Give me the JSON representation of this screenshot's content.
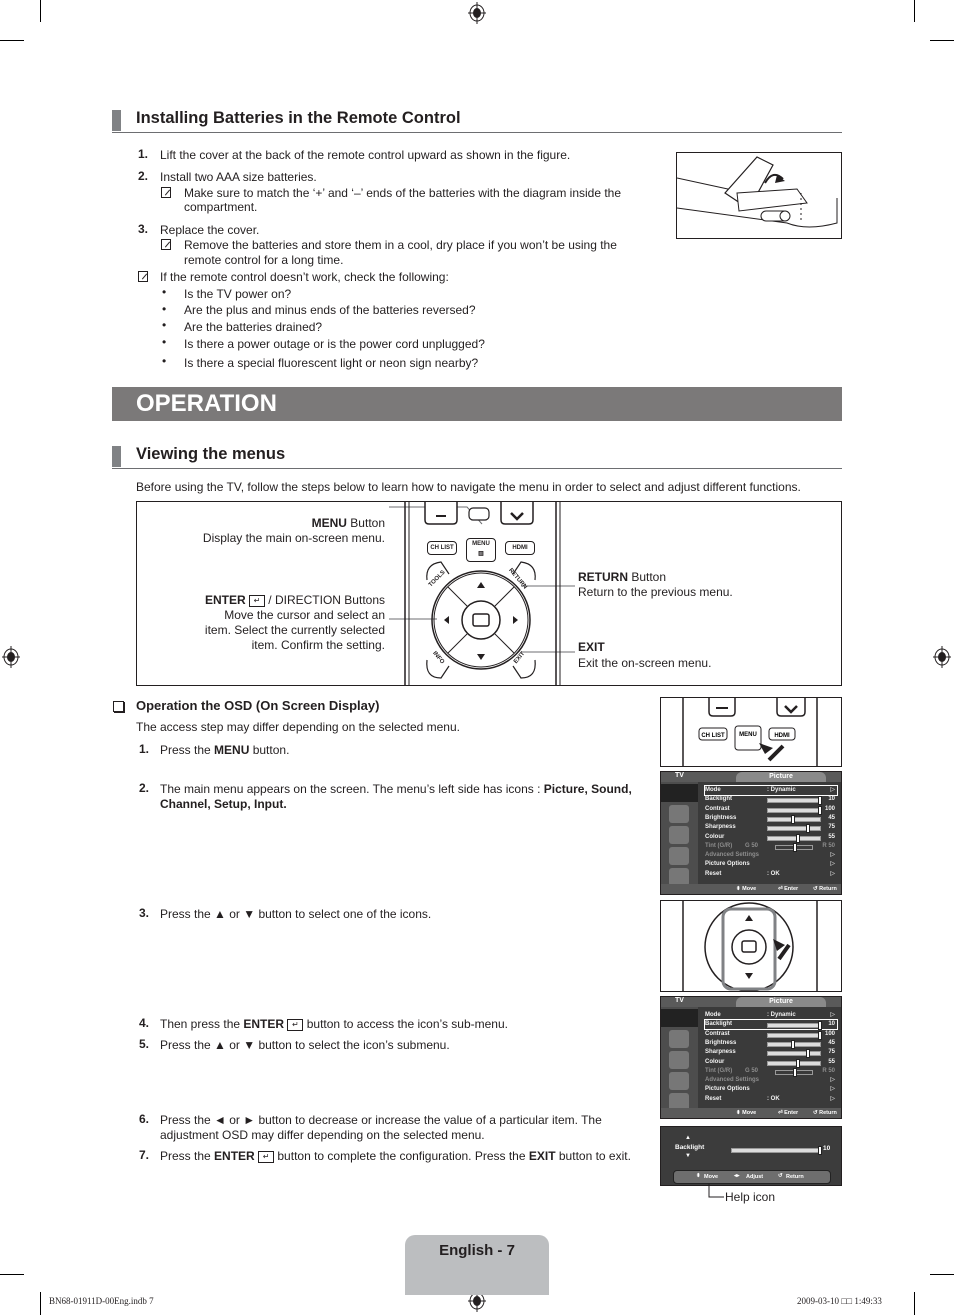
{
  "batteries": {
    "heading": "Installing Batteries in the Remote Control",
    "steps": [
      {
        "num": "1.",
        "text": "Lift the cover at the back of the remote control upward as shown in the figure."
      },
      {
        "num": "2.",
        "text": "Install two AAA size batteries.",
        "note_line1": "Make sure to match the ‘+’ and ‘–’ ends of the batteries with the diagram inside the",
        "note_line2": "compartment."
      },
      {
        "num": "3.",
        "text": "Replace the cover.",
        "note_line1": "Remove the batteries and store them in a cool, dry place if you won’t be using the",
        "note_line2": "remote control for a long time."
      }
    ],
    "troubleshoot_note": "If the remote control doesn’t work, check the following:",
    "bullets": [
      "Is the TV power on?",
      "Are the plus and minus ends of the batteries reversed?",
      "Are the batteries drained?",
      "Is there a power outage or is the power cord unplugged?",
      "Is there a special fluorescent light or neon sign nearby?"
    ]
  },
  "operation": {
    "banner": "OPERATION",
    "heading": "Viewing the menus",
    "intro": "Before using the TV, follow the steps below to learn how to navigate the menu in order to select and adjust different functions.",
    "callouts": {
      "menu_bold": "MENU",
      "menu_rest": " Button",
      "menu_desc": "Display the main on-screen menu.",
      "enter_bold": "ENTER",
      "enter_rest": " / DIRECTION Buttons",
      "enter_desc1": "Move the cursor and select an",
      "enter_desc2": "item. Select the currently selected",
      "enter_desc3": "item. Confirm the setting.",
      "return_bold": "RETURN",
      "return_rest": " Button",
      "return_desc": "Return to the previous menu.",
      "exit_bold": "EXIT",
      "exit_desc": "Exit the on-screen menu."
    },
    "remote_labels": {
      "chlist": "CH LIST",
      "menu": "MENU",
      "hdmi": "HDMI",
      "tools": "TOOLS",
      "return": "RETURN",
      "info": "INFO",
      "exit": "EXIT"
    }
  },
  "osd_section": {
    "heading": "Operation the OSD (On Screen Display)",
    "subtext": "The access step may differ depending on the selected menu.",
    "steps": [
      {
        "num": "1.",
        "pre": "Press the ",
        "bold": "MENU",
        "post": " button."
      },
      {
        "num": "2.",
        "line1_pre": "The main menu appears on the screen. The menu’s left side has icons : ",
        "line1_bold": "Picture, Sound,",
        "line2_bold": "Channel, Setup, Input."
      },
      {
        "num": "3.",
        "text": "Press the ▲ or ▼ button to select one of the icons."
      },
      {
        "num": "4.",
        "pre": "Then press the ",
        "bold": "ENTER",
        "post": " button to access the icon’s sub-menu."
      },
      {
        "num": "5.",
        "text": "Press the ▲ or ▼ button to select the icon’s submenu."
      },
      {
        "num": "6.",
        "line1": "Press the ◄ or ► button to decrease or increase the value of a particular item. The",
        "line2": "adjustment OSD may differ depending on the selected menu."
      },
      {
        "num": "7.",
        "pre": "Press the ",
        "bold": "ENTER",
        "mid": " button to complete the configuration. Press the ",
        "bold2": "EXIT",
        "post": " button to exit."
      }
    ],
    "help_icon_label": "Help icon"
  },
  "osd_menu": {
    "tv_label": "TV",
    "title": "Picture",
    "rows": [
      {
        "label": "Mode",
        "value": ": Dynamic",
        "arrow": "▷"
      },
      {
        "label": "Backlight",
        "level": 10,
        "max": 10,
        "num": "10"
      },
      {
        "label": "Contrast",
        "level": 100,
        "max": 100,
        "num": "100"
      },
      {
        "label": "Brightness",
        "level": 45,
        "max": 100,
        "num": "45"
      },
      {
        "label": "Sharpness",
        "level": 75,
        "max": 100,
        "num": "75"
      },
      {
        "label": "Colour",
        "level": 55,
        "max": 100,
        "num": "55"
      },
      {
        "label": "Tint (G/R)",
        "g": "G  50",
        "r": "R  50"
      },
      {
        "label": "Advanced Settings",
        "arrow": "▷"
      },
      {
        "label": "Picture Options",
        "arrow": "▷"
      },
      {
        "label": "Reset",
        "value": ": OK",
        "arrow": "▷"
      }
    ],
    "footer_move": "Move",
    "footer_enter": "Enter",
    "footer_return": "Return"
  },
  "osd_adjust": {
    "label": "Backlight",
    "level": 10,
    "max": 10,
    "num": "10",
    "footer_move": "Move",
    "footer_adjust": "Adjust",
    "footer_return": "Return"
  },
  "page_footer": {
    "page_label": "English - 7",
    "slug_left": "BN68-01911D-00Eng.indb   7",
    "slug_right": "2009-03-10   □□ 1:49:33"
  }
}
